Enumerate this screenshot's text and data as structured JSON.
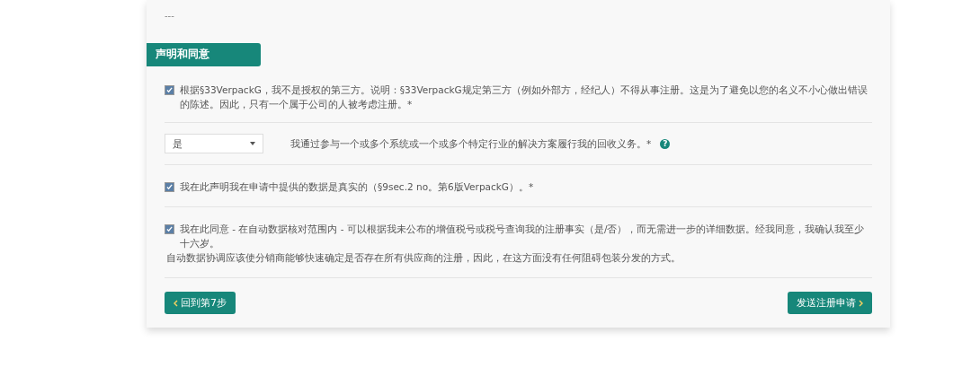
{
  "previous_value": "---",
  "section": {
    "title": "声明和同意"
  },
  "items": [
    {
      "kind": "checkbox",
      "checked": true,
      "text": "根据§33VerpackG，我不是授权的第三方。说明：§33VerpackG规定第三方（例如外部方，经纪人）不得从事注册。这是为了避免以您的名义不小心做出错误的陈述。因此，只有一个属于公司的人被考虑注册。*"
    },
    {
      "kind": "select",
      "value": "是",
      "text": "我通过参与一个或多个系统或一个或多个特定行业的解决方案履行我的回收义务。*",
      "help": "?"
    },
    {
      "kind": "checkbox",
      "checked": true,
      "text": "我在此声明我在申请中提供的数据是真实的（§9sec.2 no。第6版VerpackG）。*"
    },
    {
      "kind": "checkbox",
      "checked": true,
      "text": "我在此同意 - 在自动数据核对范围内 - 可以根据我未公布的增值税号或税号查询我的注册事实（是/否），而无需进一步的详细数据。经我同意，我确认我至少十六岁。",
      "note": "自动数据协调应该使分销商能够快速确定是否存在所有供应商的注册，因此，在这方面没有任何阻碍包装分发的方式。"
    }
  ],
  "buttons": [
    {
      "kind": "back",
      "label": "回到第7步"
    },
    {
      "kind": "next",
      "label": "发送注册申请"
    }
  ]
}
